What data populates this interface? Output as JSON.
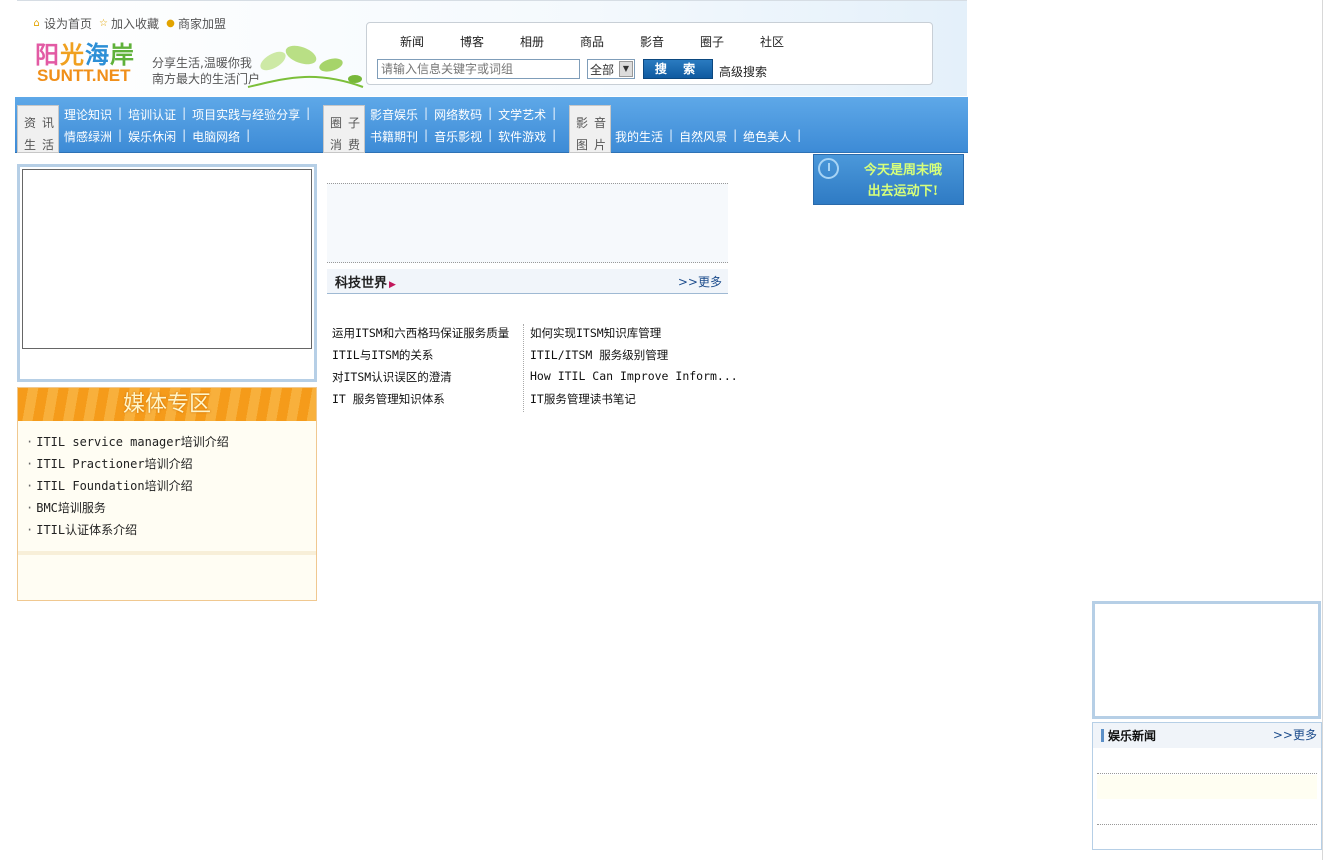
{
  "header": {
    "quick_links": [
      {
        "label": "设为首页",
        "icon": "home-icon"
      },
      {
        "label": "加入收藏",
        "icon": "star-icon"
      },
      {
        "label": "商家加盟",
        "icon": "coin-icon"
      }
    ],
    "logo_cn": [
      "阳",
      "光",
      "海",
      "岸"
    ],
    "logo_en": "SUNTT.NET",
    "slogan_line1": "分享生活,温暖你我",
    "slogan_line2": "南方最大的生活门户"
  },
  "search": {
    "tabs": [
      "新闻",
      "博客",
      "相册",
      "商品",
      "影音",
      "圈子",
      "社区"
    ],
    "placeholder": "请输入信息关键字或词组",
    "scope_value": "全部",
    "button_label": "搜 索",
    "advanced_label": "高级搜索"
  },
  "nav": {
    "groups": [
      {
        "label_chars": [
          "资",
          "讯",
          "生",
          "活"
        ],
        "row1": [
          "理论知识",
          "培训认证",
          "项目实践与经验分享"
        ],
        "row2": [
          "情感绿洲",
          "娱乐休闲",
          "电脑网络"
        ]
      },
      {
        "label_chars": [
          "圈",
          "子",
          "消",
          "费"
        ],
        "row1": [
          "影音娱乐",
          "网络数码",
          "文学艺术"
        ],
        "row2": [
          "书籍期刊",
          "音乐影视",
          "软件游戏"
        ]
      },
      {
        "label_chars": [
          "影",
          "音",
          "图",
          "片"
        ],
        "row1": [],
        "row2": [
          "我的生活",
          "自然风景",
          "绝色美人"
        ]
      }
    ],
    "separator": "|"
  },
  "media": {
    "title": "媒体专区",
    "items": [
      "ITIL service manager培训介绍",
      "ITIL Practioner培训介绍",
      "ITIL Foundation培训介绍",
      "BMC培训服务",
      "ITIL认证体系介绍"
    ]
  },
  "tech": {
    "title": "科技世界",
    "more": ">>更多",
    "col1": [
      "运用ITSM和六西格玛保证服务质量",
      "ITIL与ITSM的关系",
      "对ITSM认识误区的澄清",
      "IT 服务管理知识体系"
    ],
    "col2": [
      "如何实现ITSM知识库管理",
      "ITIL/ITSM 服务级别管理",
      "How ITIL Can Improve Inform...",
      "IT服务管理读书笔记"
    ]
  },
  "weekend": {
    "line1": "今天是周末哦",
    "line2": "出去运动下!",
    "icon": "clock-icon"
  },
  "entertainment": {
    "title": "娱乐新闻",
    "more": ">>更多"
  }
}
